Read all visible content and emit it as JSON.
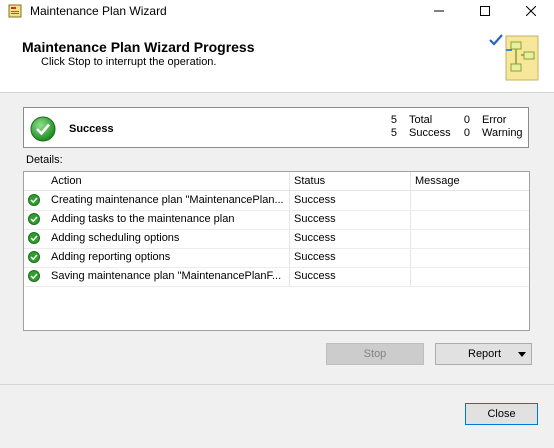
{
  "window": {
    "title": "Maintenance Plan Wizard",
    "controls": [
      "minimize",
      "maximize",
      "close"
    ]
  },
  "header": {
    "title": "Maintenance Plan Wizard Progress",
    "subtitle": "Click Stop to interrupt the operation."
  },
  "summary": {
    "status": "Success",
    "total_count": "5",
    "total_label": "Total",
    "success_count": "5",
    "success_label": "Success",
    "error_count": "0",
    "error_label": "Error",
    "warning_count": "0",
    "warning_label": "Warning"
  },
  "details": {
    "label": "Details:",
    "columns": [
      "Action",
      "Status",
      "Message"
    ],
    "rows": [
      {
        "action": "Creating maintenance plan \"MaintenancePlan...",
        "status": "Success",
        "message": "",
        "icon": "success-icon"
      },
      {
        "action": "Adding tasks to the maintenance plan",
        "status": "Success",
        "message": "",
        "icon": "success-icon"
      },
      {
        "action": "Adding scheduling options",
        "status": "Success",
        "message": "",
        "icon": "success-icon"
      },
      {
        "action": "Adding reporting options",
        "status": "Success",
        "message": "",
        "icon": "success-icon"
      },
      {
        "action": "Saving maintenance plan \"MaintenancePlanF...",
        "status": "Success",
        "message": "",
        "icon": "success-icon"
      }
    ]
  },
  "buttons": {
    "stop": "Stop",
    "report": "Report",
    "close": "Close"
  },
  "colors": {
    "success_green": "#2f9e2f",
    "accent_blue": "#0078d7"
  }
}
